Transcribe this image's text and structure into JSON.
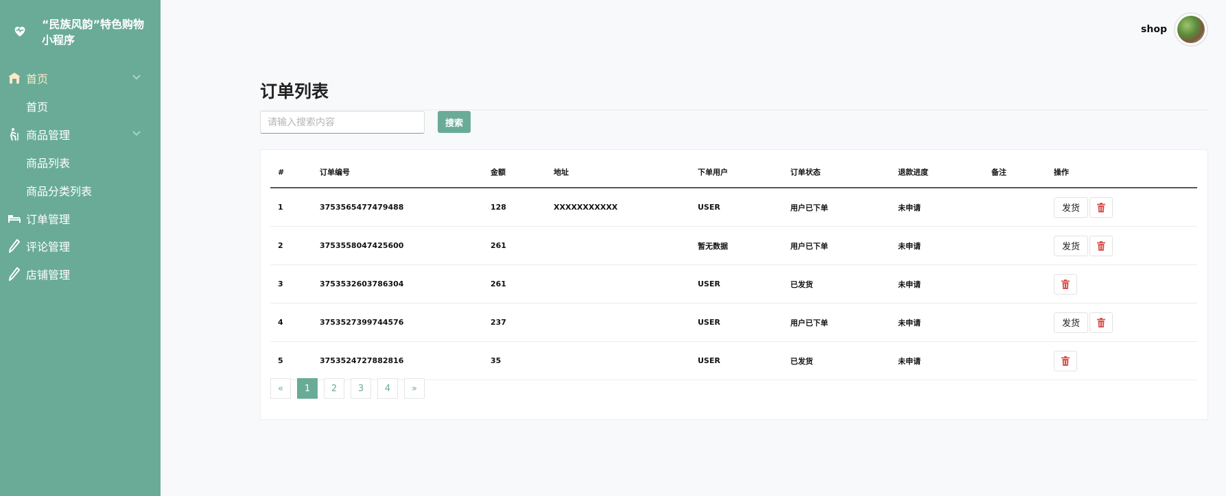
{
  "brand": {
    "title": "“民族风韵”特色购物小程序",
    "icon": "heart-pulse-icon"
  },
  "nav": {
    "home": {
      "label": "首页",
      "icon": "home-icon"
    },
    "home_sub": {
      "label": "首页"
    },
    "goods": {
      "label": "商品管理",
      "icon": "hiker-icon"
    },
    "goods_sub1": {
      "label": "商品列表"
    },
    "goods_sub2": {
      "label": "商品分类列表"
    },
    "orders": {
      "label": "订单管理",
      "icon": "bed-icon"
    },
    "comments": {
      "label": "评论管理",
      "icon": "pen-icon"
    },
    "shops": {
      "label": "店铺管理",
      "icon": "pen-icon"
    }
  },
  "user": {
    "name": "shop"
  },
  "page": {
    "title": "订单列表"
  },
  "search": {
    "placeholder": "请输入搜索内容",
    "value": "",
    "button": "搜索"
  },
  "table": {
    "headers": [
      "#",
      "订单编号",
      "金额",
      "地址",
      "下单用户",
      "订单状态",
      "退款进度",
      "备注",
      "操作"
    ],
    "rows": [
      {
        "no": "1",
        "order_id": "3753565477479488",
        "amount": "128",
        "address": "XXXXXXXXXXX",
        "user": "USER",
        "status": "用户已下单",
        "refund": "未申请",
        "note": "",
        "ship": "发货"
      },
      {
        "no": "2",
        "order_id": "3753558047425600",
        "amount": "261",
        "address": "",
        "user": "暂无数据",
        "status": "用户已下单",
        "refund": "未申请",
        "note": "",
        "ship": "发货"
      },
      {
        "no": "3",
        "order_id": "3753532603786304",
        "amount": "261",
        "address": "",
        "user": "USER",
        "status": "已发货",
        "refund": "未申请",
        "note": "",
        "ship": ""
      },
      {
        "no": "4",
        "order_id": "3753527399744576",
        "amount": "237",
        "address": "",
        "user": "USER",
        "status": "用户已下单",
        "refund": "未申请",
        "note": "",
        "ship": "发货"
      },
      {
        "no": "5",
        "order_id": "3753524727882816",
        "amount": "35",
        "address": "",
        "user": "USER",
        "status": "已发货",
        "refund": "未申请",
        "note": "",
        "ship": ""
      }
    ]
  },
  "pagination": {
    "prev": "«",
    "pages": [
      "1",
      "2",
      "3",
      "4"
    ],
    "current": "1",
    "next": "»"
  },
  "colors": {
    "accent": "#6aab97",
    "danger": "#d9534f",
    "active_nav": "#fde9c8"
  }
}
